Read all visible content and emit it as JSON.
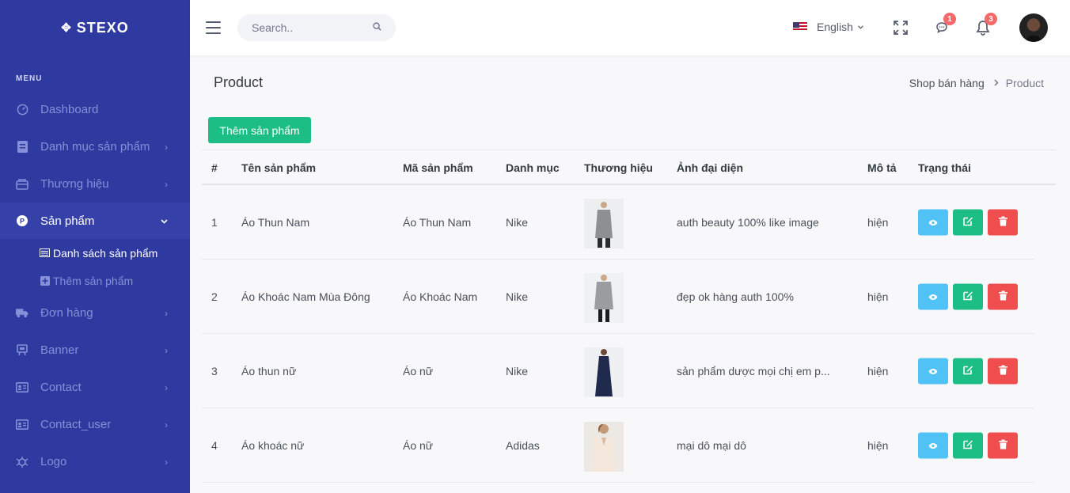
{
  "brand": {
    "name": "STEXO"
  },
  "sidebar": {
    "menu_title": "MENU",
    "items": [
      {
        "label": "Dashboard",
        "icon": "dashboard-icon",
        "has_children": false
      },
      {
        "label": "Danh mục sản phẩm",
        "icon": "category-icon",
        "has_children": true
      },
      {
        "label": "Thương hiệu",
        "icon": "brand-icon",
        "has_children": true
      },
      {
        "label": "Sản phẩm",
        "icon": "product-icon",
        "has_children": true,
        "active": true,
        "children": [
          {
            "label": "Danh sách sản phẩm",
            "icon": "list-icon",
            "active": true
          },
          {
            "label": "Thêm sản phẩm",
            "icon": "plus-square-icon"
          }
        ]
      },
      {
        "label": "Đơn hàng",
        "icon": "truck-icon",
        "has_children": true
      },
      {
        "label": "Banner",
        "icon": "banner-icon",
        "has_children": true
      },
      {
        "label": "Contact",
        "icon": "contact-icon",
        "has_children": true
      },
      {
        "label": "Contact_user",
        "icon": "contact-user-icon",
        "has_children": true
      },
      {
        "label": "Logo",
        "icon": "logo-icon",
        "has_children": true
      }
    ]
  },
  "topbar": {
    "search_placeholder": "Search..",
    "language": "English",
    "chat_badge": "1",
    "notification_badge": "3"
  },
  "page": {
    "title": "Product",
    "breadcrumb": [
      "Shop bán hàng",
      "Product"
    ],
    "add_button": "Thêm sản phẩm"
  },
  "table": {
    "columns": [
      "#",
      "Tên sản phẩm",
      "Mã sản phẩm",
      "Danh mục",
      "Thương hiệu",
      "Ảnh đại diện",
      "Mô tả",
      "Trạng thái"
    ],
    "rows": [
      {
        "index": "1",
        "name": "Áo Thun Nam",
        "code": "Áo Thun Nam",
        "category": "Nike",
        "description": "auth beauty 100% like image",
        "status": "hiện"
      },
      {
        "index": "2",
        "name": "Áo Khoác Nam Mùa Đông",
        "code": "Áo Khoác Nam",
        "category": "Nike",
        "description": "đẹp ok hàng auth 100%",
        "status": "hiện"
      },
      {
        "index": "3",
        "name": "Áo thun nữ",
        "code": "Áo nữ",
        "category": "Nike",
        "description": "sản phẩm dược mọi chị em p...",
        "status": "hiện"
      },
      {
        "index": "4",
        "name": "Áo khoác nữ",
        "code": "Áo nữ",
        "category": "Adidas",
        "description": "mại dô mại dô",
        "status": "hiện"
      }
    ]
  },
  "colors": {
    "sidebar": "#2e3a9f",
    "accent_green": "#1dbe86",
    "accent_blue": "#50c2f5",
    "accent_red": "#f04e4e",
    "badge": "#f46a6a"
  }
}
